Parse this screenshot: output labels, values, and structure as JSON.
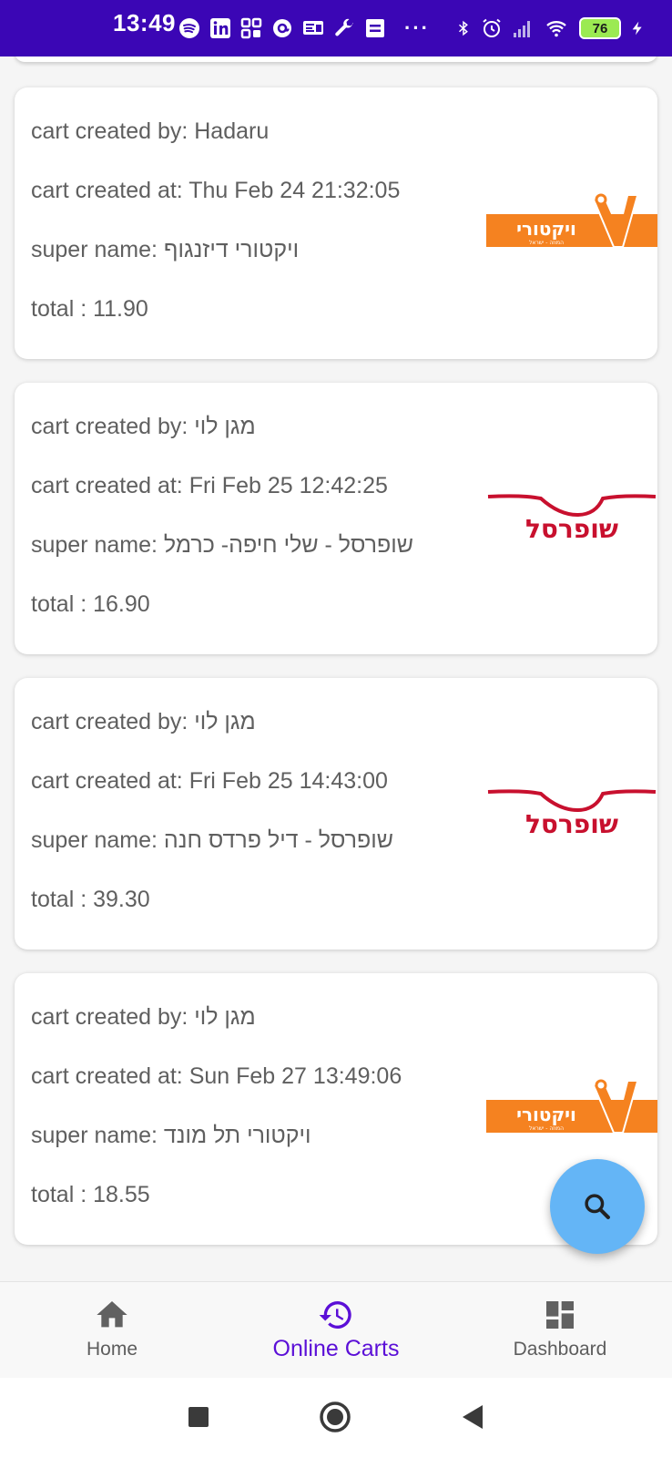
{
  "status_bar": {
    "time": "13:49",
    "battery": "76",
    "overflow": "···",
    "left_icons": [
      "spotify-icon",
      "linkedin-icon",
      "apps-grid-icon",
      "at-sign-icon",
      "message-icon",
      "wrench-icon",
      "sim-icon"
    ],
    "right_icons": [
      "bluetooth-icon",
      "alarm-icon",
      "signal-icon",
      "wifi-icon",
      "battery-icon",
      "charging-icon"
    ]
  },
  "carts": [
    {
      "created_by_label": "cart created by: ",
      "created_by": "Hadaru",
      "created_at_label": "cart created at: ",
      "created_at": "Thu Feb 24 21:32:05",
      "super_label": "super name: ",
      "super_name": "ויקטורי דיזנגוף",
      "total_label": "total : ",
      "total": "11.90",
      "logo": "victory",
      "logo_text": "ויקטורי",
      "logo_subtext": "המוזה - ישראל"
    },
    {
      "created_by_label": "cart created by: ",
      "created_by": "מגן לוי",
      "created_at_label": "cart created at: ",
      "created_at": "Fri Feb 25 12:42:25",
      "super_label": "super name: ",
      "super_name": "שופרסל  - שלי חיפה- כרמל",
      "total_label": "total : ",
      "total": "16.90",
      "logo": "shufersal",
      "logo_text": "שופרסל"
    },
    {
      "created_by_label": "cart created by: ",
      "created_by": "מגן לוי",
      "created_at_label": "cart created at: ",
      "created_at": "Fri Feb 25 14:43:00",
      "super_label": "super name: ",
      "super_name": "שופרסל  - דיל פרדס חנה",
      "total_label": "total : ",
      "total": "39.30",
      "logo": "shufersal",
      "logo_text": "שופרסל"
    },
    {
      "created_by_label": "cart created by: ",
      "created_by": "מגן לוי",
      "created_at_label": "cart created at: ",
      "created_at": "Sun Feb 27 13:49:06",
      "super_label": "super name: ",
      "super_name": "ויקטורי תל מונד",
      "total_label": "total : ",
      "total": "18.55",
      "logo": "victory",
      "logo_text": "ויקטורי",
      "logo_subtext": "המוזה - ישראל"
    }
  ],
  "fab": {
    "icon": "search-icon"
  },
  "bottom_nav": {
    "items": [
      {
        "label": "Home",
        "icon": "home-icon",
        "active": false
      },
      {
        "label": "Online Carts",
        "icon": "history-icon",
        "active": true
      },
      {
        "label": "Dashboard",
        "icon": "dashboard-icon",
        "active": false
      }
    ]
  },
  "colors": {
    "status_bar": "#3b06b5",
    "accent": "#5b0fd7",
    "fab": "#64b5f6",
    "victory_orange": "#f58220",
    "shufersal_red": "#c8102e"
  }
}
